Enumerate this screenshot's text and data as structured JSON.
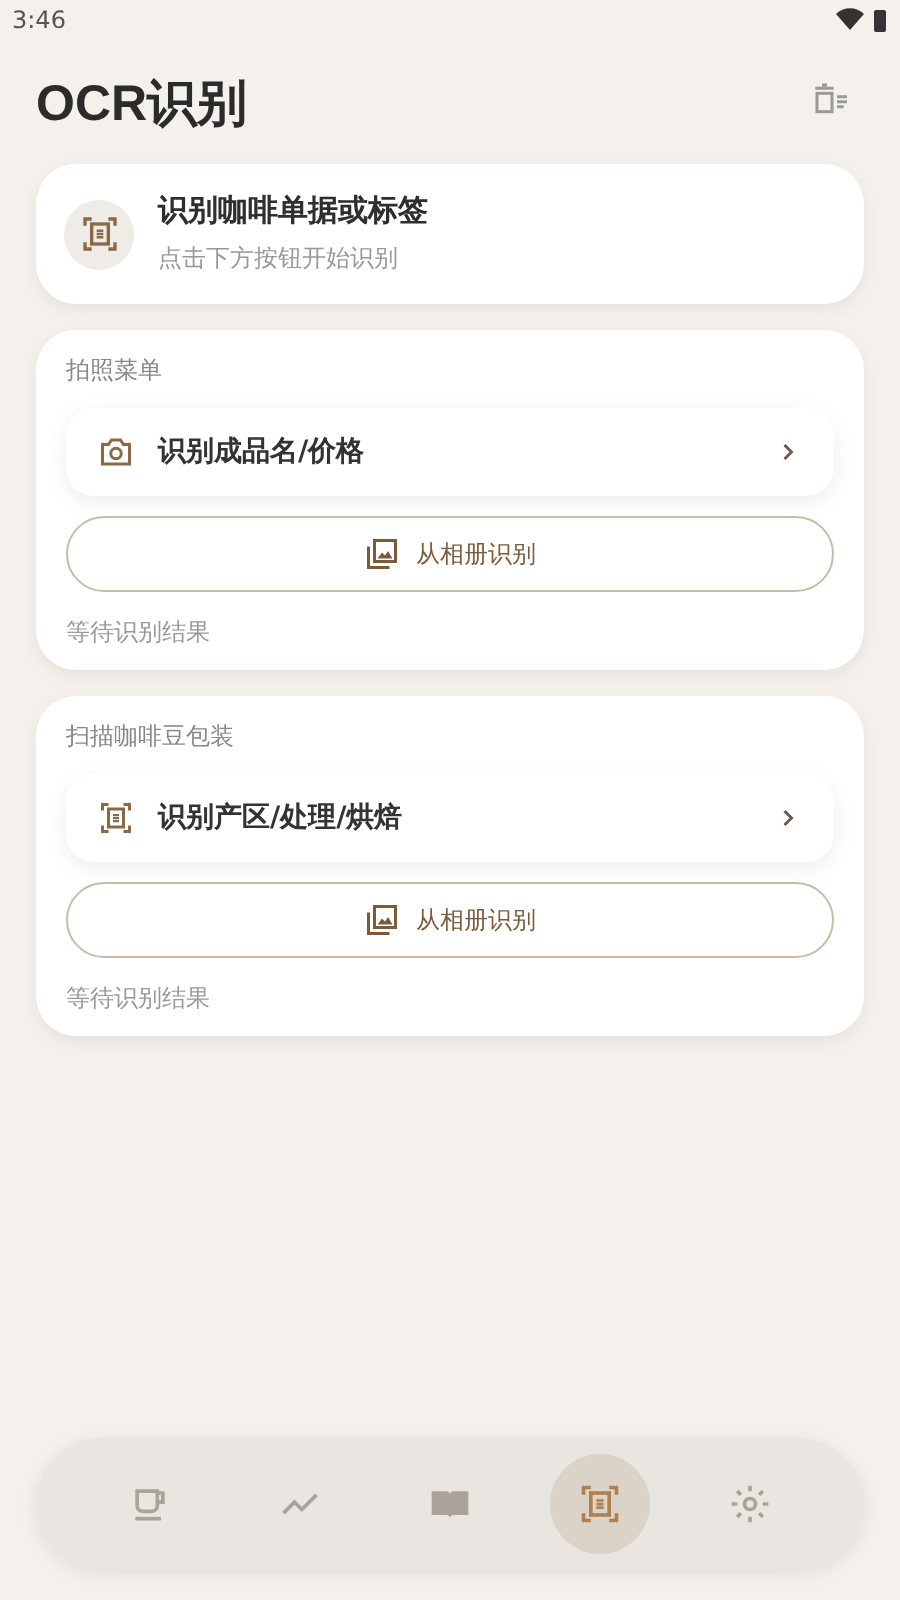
{
  "status_bar": {
    "time": "3:46"
  },
  "header": {
    "title": "OCR识别"
  },
  "hero": {
    "title": "识别咖啡单据或标签",
    "subtitle": "点击下方按钮开始识别"
  },
  "sections": [
    {
      "title": "拍照菜单",
      "action": {
        "kind": "camera",
        "label": "识别成品名/价格"
      },
      "album_button": "从相册识别",
      "status": "等待识别结果"
    },
    {
      "title": "扫描咖啡豆包装",
      "action": {
        "kind": "scan",
        "label": "识别产区/处理/烘焙"
      },
      "album_button": "从相册识别",
      "status": "等待识别结果"
    }
  ],
  "nav": [
    {
      "kind": "cup",
      "selected": false
    },
    {
      "kind": "trend",
      "selected": false
    },
    {
      "kind": "book",
      "selected": false
    },
    {
      "kind": "scan",
      "selected": true
    },
    {
      "kind": "gear",
      "selected": false
    }
  ]
}
